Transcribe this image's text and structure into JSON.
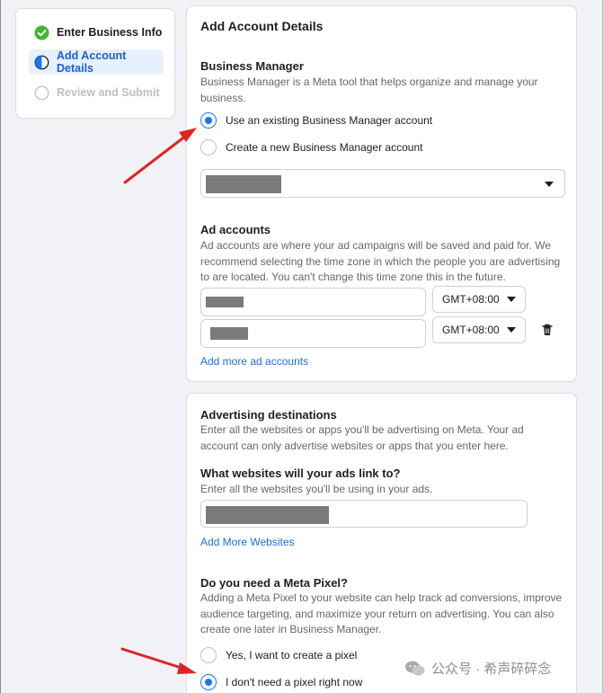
{
  "stepper": {
    "steps": [
      {
        "label": "Enter Business Info",
        "state": "completed"
      },
      {
        "label": "Add Account Details",
        "state": "current"
      },
      {
        "label": "Review and Submit",
        "state": "pending"
      }
    ]
  },
  "account_details": {
    "title": "Add Account Details",
    "business_manager": {
      "heading": "Business Manager",
      "description": "Business Manager is a Meta tool that helps organize and manage your business.",
      "options": [
        {
          "label": "Use an existing Business Manager account",
          "selected": true
        },
        {
          "label": "Create a new Business Manager account",
          "selected": false
        }
      ]
    },
    "ad_accounts": {
      "heading": "Ad accounts",
      "description": "Ad accounts are where your ad campaigns will be saved and paid for. We recommend selecting the time zone in which the people you are advertising to are located. You can't change this time zone this in the future.",
      "rows": [
        {
          "timezone": "GMT+08:00"
        },
        {
          "timezone": "GMT+08:00"
        }
      ],
      "add_more_label": "Add more ad accounts"
    }
  },
  "destinations": {
    "heading": "Advertising destinations",
    "description": "Enter all the websites or apps you'll be advertising on Meta. Your ad account can only advertise websites or apps that you enter here.",
    "websites": {
      "heading": "What websites will your ads link to?",
      "description": "Enter all the websites you'll be using in your ads.",
      "add_more_label": "Add More Websites"
    },
    "pixel": {
      "heading": "Do you need a Meta Pixel?",
      "description": "Adding a Meta Pixel to your website can help track ad conversions, improve audience targeting, and maximize your return on advertising. You can also create one later in Business Manager.",
      "options": [
        {
          "label": "Yes, I want to create a pixel",
          "selected": false
        },
        {
          "label": "I don't need a pixel right now",
          "selected": true
        }
      ]
    }
  },
  "watermark": {
    "text": "公众号 · 希声碎碎念"
  },
  "colors": {
    "accent": "#1877f2",
    "success": "#42b72a",
    "annotation_arrow": "#e02424"
  }
}
